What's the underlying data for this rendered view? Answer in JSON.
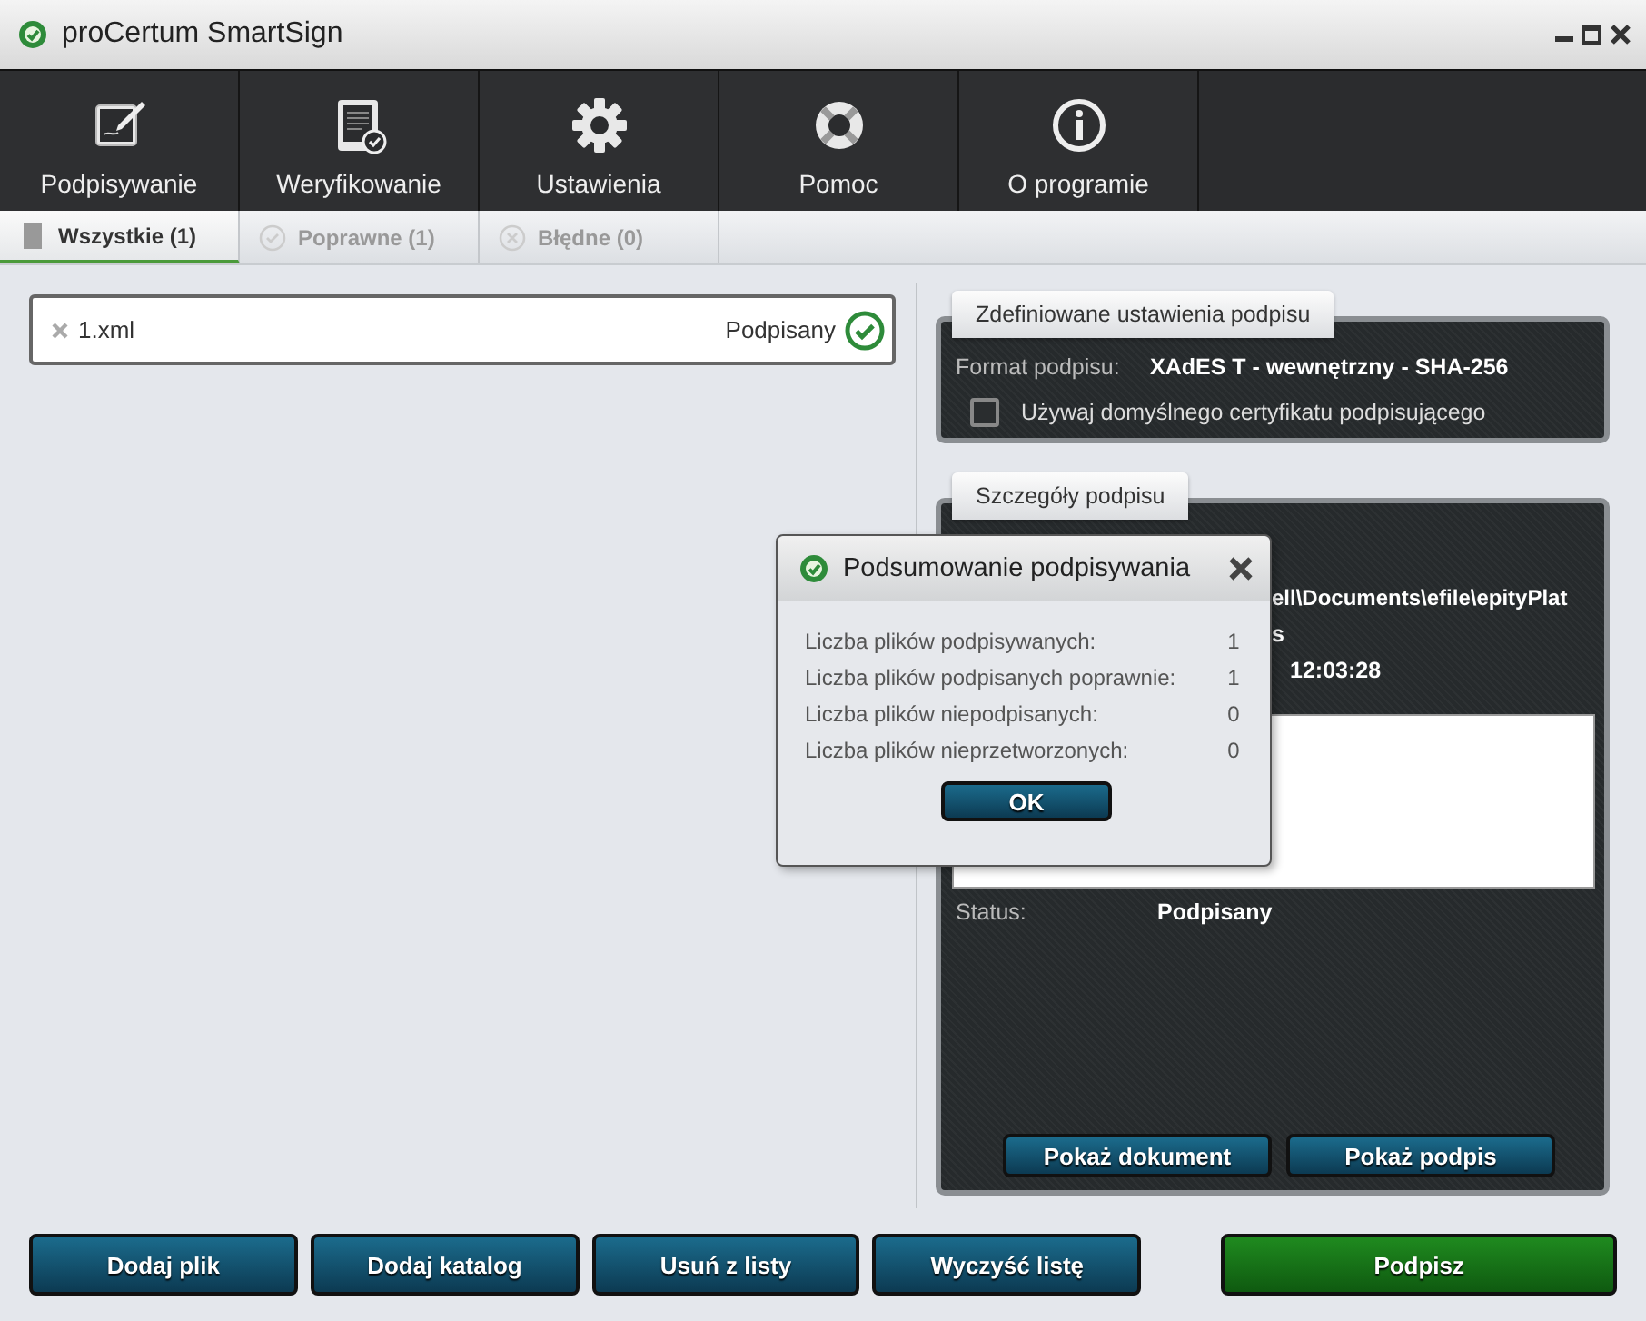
{
  "window": {
    "title": "proCertum SmartSign"
  },
  "toolbar": [
    {
      "label": "Podpisywanie",
      "kind": "sign"
    },
    {
      "label": "Weryfikowanie",
      "kind": "verify"
    },
    {
      "label": "Ustawienia",
      "kind": "settings"
    },
    {
      "label": "Pomoc",
      "kind": "help"
    },
    {
      "label": "O programie",
      "kind": "about"
    }
  ],
  "tabs": [
    {
      "label": "Wszystkie (1)",
      "selected": true,
      "kind": "all"
    },
    {
      "label": "Poprawne (1)",
      "selected": false,
      "kind": "valid"
    },
    {
      "label": "Błędne (0)",
      "selected": false,
      "kind": "invalid"
    }
  ],
  "files": [
    {
      "name": "1.xml",
      "status": "Podpisany",
      "signed": true
    }
  ],
  "settings_panel": {
    "title": "Zdefiniowane ustawienia podpisu",
    "format_label": "Format podpisu:",
    "format_value": "XAdES T - wewnętrzny - SHA-256",
    "checkbox": {
      "label": "Używaj domyślnego certyfikatu podpisującego",
      "checked": false
    }
  },
  "details_panel": {
    "title": "Szczegóły podpisu",
    "fragments": [
      "ell\\Documents\\efile\\epityPlat",
      "s",
      "12:03:28"
    ],
    "status_label": "Status:",
    "status_value": "Podpisany",
    "buttons": [
      "Pokaż dokument",
      "Pokaż podpis"
    ]
  },
  "dialog": {
    "title": "Podsumowanie podpisywania",
    "rows": [
      {
        "label": "Liczba plików podpisywanych:",
        "value": "1"
      },
      {
        "label": "Liczba plików podpisanych poprawnie:",
        "value": "1"
      },
      {
        "label": "Liczba plików niepodpisanych:",
        "value": "0"
      },
      {
        "label": "Liczba plików nieprzetworzonych:",
        "value": "0"
      }
    ],
    "ok": "OK"
  },
  "actions": [
    {
      "label": "Dodaj plik",
      "kind": "normal"
    },
    {
      "label": "Dodaj katalog",
      "kind": "normal"
    },
    {
      "label": "Usuń z listy",
      "kind": "normal"
    },
    {
      "label": "Wyczyść listę",
      "kind": "normal"
    },
    {
      "label": "Podpisz",
      "kind": "primary"
    }
  ]
}
